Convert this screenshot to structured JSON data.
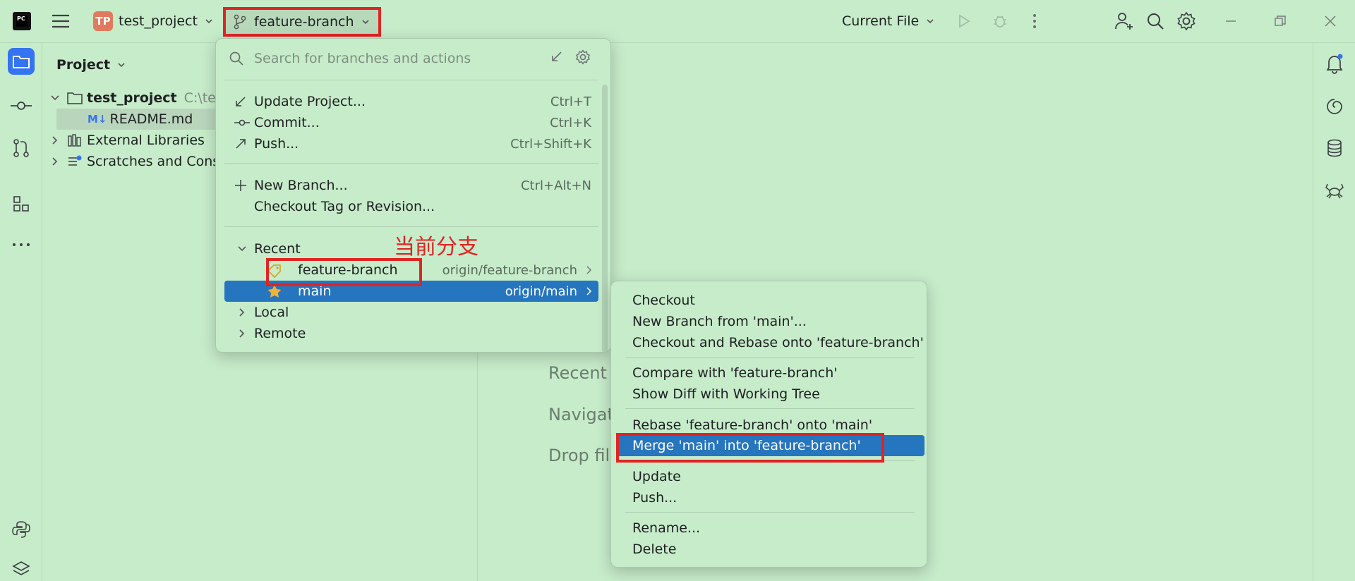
{
  "titlebar": {
    "project_initials": "TP",
    "project_name": "test_project",
    "branch": "feature-branch",
    "run_config": "Current File"
  },
  "project_panel": {
    "title": "Project",
    "tree": [
      {
        "label": "test_project",
        "suffix": "C:\\tes",
        "bold": true
      },
      {
        "label": "README.md",
        "file_badge": "M↓"
      },
      {
        "label": "External Libraries"
      },
      {
        "label": "Scratches and Cons"
      }
    ]
  },
  "editor_hints": [
    "Recent",
    "Navigat",
    "Drop fil"
  ],
  "branch_popup": {
    "search_placeholder": "Search for branches and actions",
    "actions": [
      {
        "label": "Update Project...",
        "shortcut": "Ctrl+T"
      },
      {
        "label": "Commit...",
        "shortcut": "Ctrl+K"
      },
      {
        "label": "Push...",
        "shortcut": "Ctrl+Shift+K"
      }
    ],
    "branch_actions": [
      {
        "label": "New Branch...",
        "shortcut": "Ctrl+Alt+N"
      },
      {
        "label": "Checkout Tag or Revision...",
        "shortcut": ""
      }
    ],
    "recent_label": "Recent",
    "recent": [
      {
        "name": "feature-branch",
        "remote": "origin/feature-branch"
      },
      {
        "name": "main",
        "remote": "origin/main"
      }
    ],
    "local_label": "Local",
    "remote_label": "Remote"
  },
  "annotation": "当前分支",
  "submenu": {
    "groups": [
      [
        "Checkout",
        "New Branch from 'main'...",
        "Checkout and Rebase onto 'feature-branch'"
      ],
      [
        "Compare with 'feature-branch'",
        "Show Diff with Working Tree"
      ],
      [
        "Rebase 'feature-branch' onto 'main'",
        "Merge 'main' into 'feature-branch'"
      ],
      [
        "Update",
        "Push..."
      ],
      [
        "Rename...",
        "Delete"
      ]
    ]
  },
  "colors": {
    "selection": "#2675bf",
    "annotation_red": "#e02424",
    "background": "#c7ecca"
  }
}
